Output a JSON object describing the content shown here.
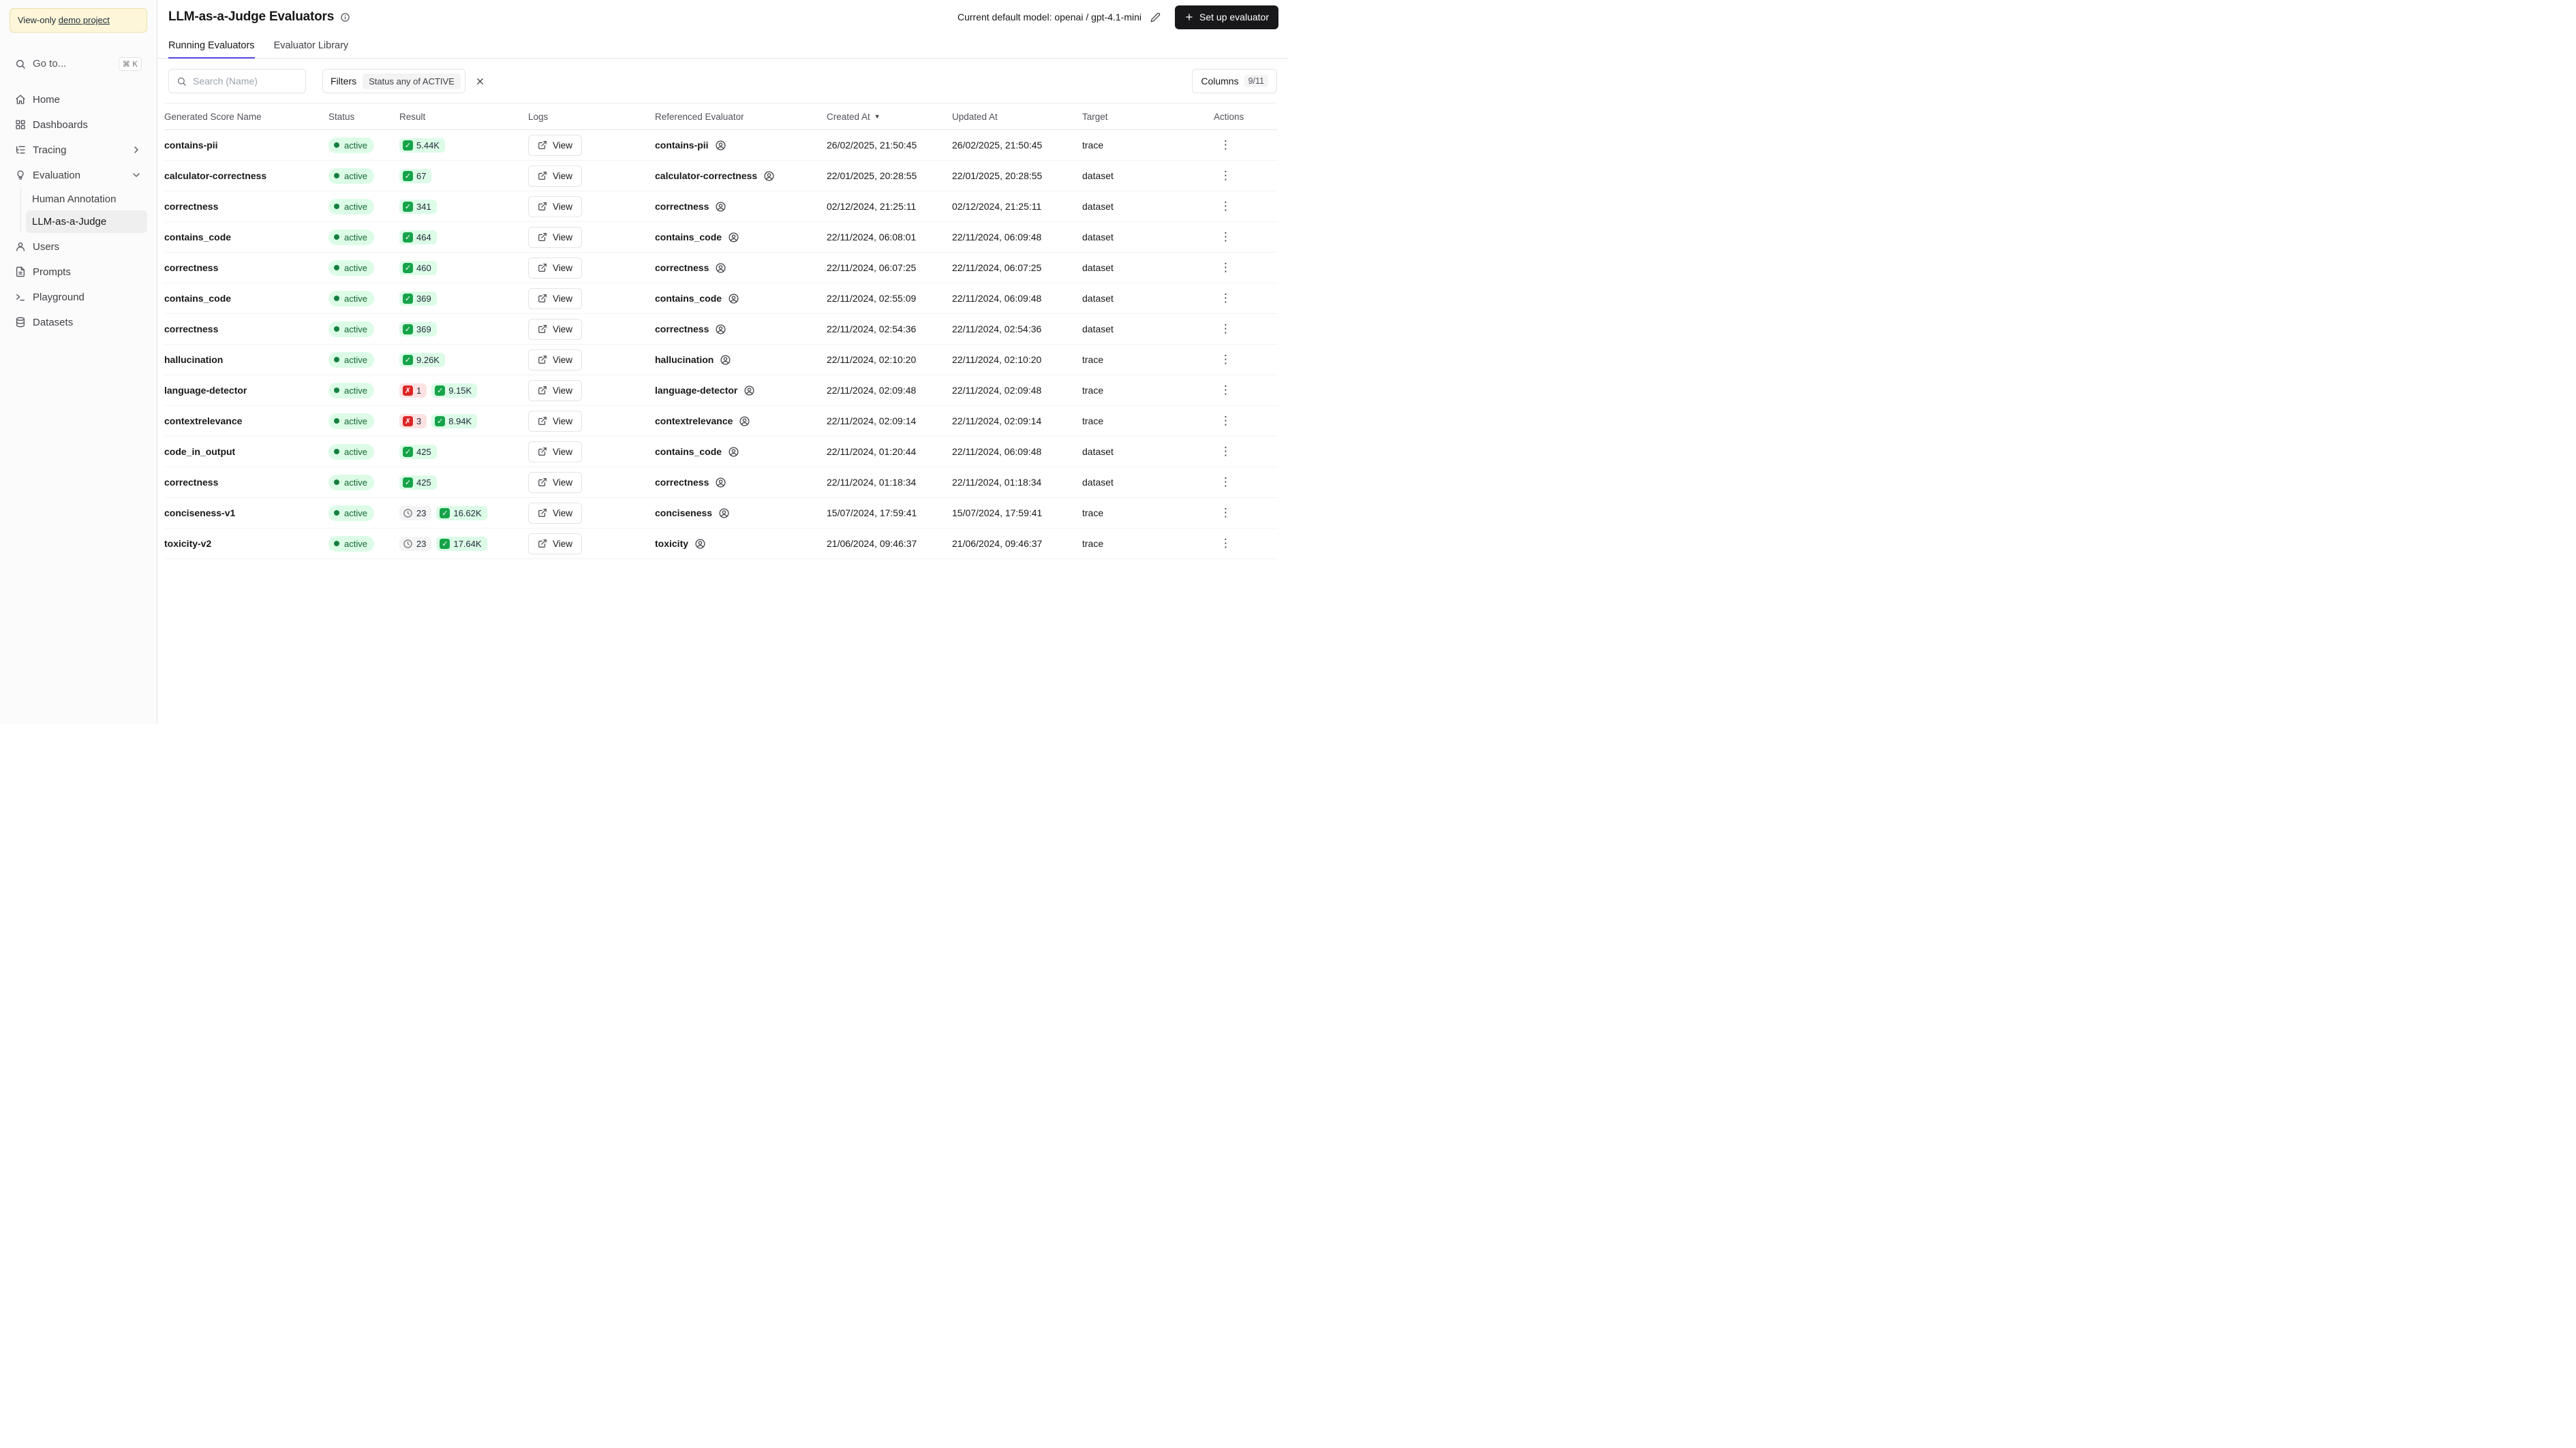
{
  "sidebar": {
    "banner": {
      "text": "View-only",
      "link": "demo project"
    },
    "goto_label": "Go to...",
    "goto_shortcut": "⌘ K",
    "items": {
      "home": "Home",
      "dashboards": "Dashboards",
      "tracing": "Tracing",
      "evaluation": "Evaluation",
      "human_annotation": "Human Annotation",
      "llm_judge": "LLM-as-a-Judge",
      "users": "Users",
      "prompts": "Prompts",
      "playground": "Playground",
      "datasets": "Datasets"
    }
  },
  "header": {
    "title": "LLM-as-a-Judge Evaluators",
    "default_model_label": "Current default model:",
    "default_model_value": "openai / gpt-4.1-mini",
    "setup_button": "Set up evaluator"
  },
  "tabs": [
    {
      "label": "Running Evaluators"
    },
    {
      "label": "Evaluator Library"
    }
  ],
  "toolbar": {
    "search_placeholder": "Search (Name)",
    "filters_label": "Filters",
    "filter_chip": "Status any of ACTIVE",
    "columns_label": "Columns",
    "columns_count": "9/11"
  },
  "table": {
    "columns": [
      "Generated Score Name",
      "Status",
      "Result",
      "Logs",
      "Referenced Evaluator",
      "Created At",
      "Updated At",
      "Target",
      "Actions"
    ],
    "sorted_column": "Created At",
    "view_label": "View",
    "status_label": "active",
    "rows": [
      {
        "name": "contains-pii",
        "results": [
          {
            "kind": "success",
            "count": "5.44K"
          }
        ],
        "evaluator": "contains-pii",
        "created": "26/02/2025, 21:50:45",
        "updated": "26/02/2025, 21:50:45",
        "target": "trace"
      },
      {
        "name": "calculator-correctness",
        "results": [
          {
            "kind": "success",
            "count": "67"
          }
        ],
        "evaluator": "calculator-correctness",
        "created": "22/01/2025, 20:28:55",
        "updated": "22/01/2025, 20:28:55",
        "target": "dataset"
      },
      {
        "name": "correctness",
        "results": [
          {
            "kind": "success",
            "count": "341"
          }
        ],
        "evaluator": "correctness",
        "created": "02/12/2024, 21:25:11",
        "updated": "02/12/2024, 21:25:11",
        "target": "dataset"
      },
      {
        "name": "contains_code",
        "results": [
          {
            "kind": "success",
            "count": "464"
          }
        ],
        "evaluator": "contains_code",
        "created": "22/11/2024, 06:08:01",
        "updated": "22/11/2024, 06:09:48",
        "target": "dataset"
      },
      {
        "name": "correctness",
        "results": [
          {
            "kind": "success",
            "count": "460"
          }
        ],
        "evaluator": "correctness",
        "created": "22/11/2024, 06:07:25",
        "updated": "22/11/2024, 06:07:25",
        "target": "dataset"
      },
      {
        "name": "contains_code",
        "results": [
          {
            "kind": "success",
            "count": "369"
          }
        ],
        "evaluator": "contains_code",
        "created": "22/11/2024, 02:55:09",
        "updated": "22/11/2024, 06:09:48",
        "target": "dataset"
      },
      {
        "name": "correctness",
        "results": [
          {
            "kind": "success",
            "count": "369"
          }
        ],
        "evaluator": "correctness",
        "created": "22/11/2024, 02:54:36",
        "updated": "22/11/2024, 02:54:36",
        "target": "dataset"
      },
      {
        "name": "hallucination",
        "results": [
          {
            "kind": "success",
            "count": "9.26K"
          }
        ],
        "evaluator": "hallucination",
        "created": "22/11/2024, 02:10:20",
        "updated": "22/11/2024, 02:10:20",
        "target": "trace"
      },
      {
        "name": "language-detector",
        "results": [
          {
            "kind": "error",
            "count": "1"
          },
          {
            "kind": "success",
            "count": "9.15K"
          }
        ],
        "evaluator": "language-detector",
        "created": "22/11/2024, 02:09:48",
        "updated": "22/11/2024, 02:09:48",
        "target": "trace"
      },
      {
        "name": "contextrelevance",
        "results": [
          {
            "kind": "error",
            "count": "3"
          },
          {
            "kind": "success",
            "count": "8.94K"
          }
        ],
        "evaluator": "contextrelevance",
        "created": "22/11/2024, 02:09:14",
        "updated": "22/11/2024, 02:09:14",
        "target": "trace"
      },
      {
        "name": "code_in_output",
        "results": [
          {
            "kind": "success",
            "count": "425"
          }
        ],
        "evaluator": "contains_code",
        "created": "22/11/2024, 01:20:44",
        "updated": "22/11/2024, 06:09:48",
        "target": "dataset"
      },
      {
        "name": "correctness",
        "results": [
          {
            "kind": "success",
            "count": "425"
          }
        ],
        "evaluator": "correctness",
        "created": "22/11/2024, 01:18:34",
        "updated": "22/11/2024, 01:18:34",
        "target": "dataset"
      },
      {
        "name": "conciseness-v1",
        "results": [
          {
            "kind": "pending",
            "count": "23"
          },
          {
            "kind": "success",
            "count": "16.62K"
          }
        ],
        "evaluator": "conciseness",
        "created": "15/07/2024, 17:59:41",
        "updated": "15/07/2024, 17:59:41",
        "target": "trace"
      },
      {
        "name": "toxicity-v2",
        "results": [
          {
            "kind": "pending",
            "count": "23"
          },
          {
            "kind": "success",
            "count": "17.64K"
          }
        ],
        "evaluator": "toxicity",
        "created": "21/06/2024, 09:46:37",
        "updated": "21/06/2024, 09:46:37",
        "target": "trace"
      }
    ]
  }
}
